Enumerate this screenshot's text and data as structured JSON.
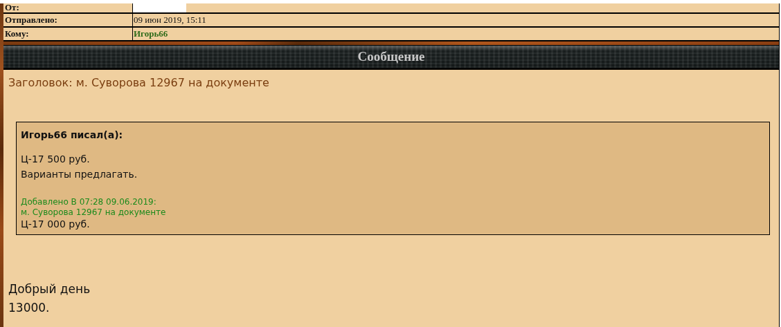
{
  "header": {
    "rows": [
      {
        "label": "От:",
        "kind": "redacted"
      },
      {
        "label": "Отправлено:",
        "kind": "text",
        "value": "09 июн 2019, 15:11"
      },
      {
        "label": "Кому:",
        "kind": "link",
        "value": "Игорь66"
      }
    ]
  },
  "section_title": "Сообщение",
  "message": {
    "subject": "Заголовок: м. Суворова 12967 на документе",
    "quote": {
      "author": "Игорь66 писал(а):",
      "lines": [
        "Ц-17 500 руб.",
        "Варианты предлагать."
      ],
      "added_note": [
        "Добавлено В 07:28 09.06.2019:",
        "м. Суворова 12967 на документе"
      ],
      "after": "Ц-17 000 руб."
    },
    "body": [
      "Добрый день",
      "13000."
    ]
  }
}
